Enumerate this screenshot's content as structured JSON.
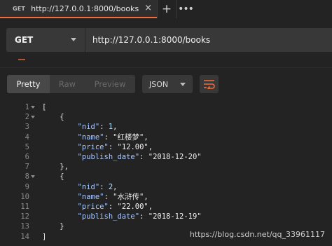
{
  "tab": {
    "method": "GET",
    "url": "http://127.0.0.1:8000/books",
    "close_glyph": "×",
    "add_glyph": "+",
    "more_glyph": "•••"
  },
  "request": {
    "method": "GET",
    "url": "http://127.0.0.1:8000/books"
  },
  "response_toolbar": {
    "views": [
      "Pretty",
      "Raw",
      "Preview"
    ],
    "active_view": "Pretty",
    "format": "JSON",
    "wrap_icon": "wrap-lines-icon"
  },
  "code": {
    "lines": [
      {
        "num": "1",
        "fold": true,
        "parts": [
          [
            "p",
            "["
          ]
        ]
      },
      {
        "num": "2",
        "fold": true,
        "parts": [
          [
            "p",
            "    {"
          ]
        ]
      },
      {
        "num": "3",
        "fold": false,
        "parts": [
          [
            "p",
            "        "
          ],
          [
            "k",
            "\"nid\""
          ],
          [
            "p",
            ": "
          ],
          [
            "n",
            "1"
          ],
          [
            "p",
            ","
          ]
        ]
      },
      {
        "num": "4",
        "fold": false,
        "parts": [
          [
            "p",
            "        "
          ],
          [
            "k",
            "\"name\""
          ],
          [
            "p",
            ": "
          ],
          [
            "s",
            "\"红楼梦\""
          ],
          [
            "p",
            ","
          ]
        ]
      },
      {
        "num": "5",
        "fold": false,
        "parts": [
          [
            "p",
            "        "
          ],
          [
            "k",
            "\"price\""
          ],
          [
            "p",
            ": "
          ],
          [
            "s",
            "\"12.00\""
          ],
          [
            "p",
            ","
          ]
        ]
      },
      {
        "num": "6",
        "fold": false,
        "parts": [
          [
            "p",
            "        "
          ],
          [
            "k",
            "\"publish_date\""
          ],
          [
            "p",
            ": "
          ],
          [
            "s",
            "\"2018-12-20\""
          ]
        ]
      },
      {
        "num": "7",
        "fold": false,
        "parts": [
          [
            "p",
            "    },"
          ]
        ]
      },
      {
        "num": "8",
        "fold": true,
        "parts": [
          [
            "p",
            "    {"
          ]
        ]
      },
      {
        "num": "9",
        "fold": false,
        "parts": [
          [
            "p",
            "        "
          ],
          [
            "k",
            "\"nid\""
          ],
          [
            "p",
            ": "
          ],
          [
            "n",
            "2"
          ],
          [
            "p",
            ","
          ]
        ]
      },
      {
        "num": "10",
        "fold": false,
        "parts": [
          [
            "p",
            "        "
          ],
          [
            "k",
            "\"name\""
          ],
          [
            "p",
            ": "
          ],
          [
            "s",
            "\"水浒传\""
          ],
          [
            "p",
            ","
          ]
        ]
      },
      {
        "num": "11",
        "fold": false,
        "parts": [
          [
            "p",
            "        "
          ],
          [
            "k",
            "\"price\""
          ],
          [
            "p",
            ": "
          ],
          [
            "s",
            "\"22.00\""
          ],
          [
            "p",
            ","
          ]
        ]
      },
      {
        "num": "12",
        "fold": false,
        "parts": [
          [
            "p",
            "        "
          ],
          [
            "k",
            "\"publish_date\""
          ],
          [
            "p",
            ": "
          ],
          [
            "s",
            "\"2018-12-19\""
          ]
        ]
      },
      {
        "num": "13",
        "fold": false,
        "parts": [
          [
            "p",
            "    }"
          ]
        ]
      },
      {
        "num": "14",
        "fold": false,
        "parts": [
          [
            "p",
            "]"
          ]
        ]
      }
    ]
  },
  "watermark": "https://blog.csdn.net/qq_33961117",
  "colors": {
    "accent": "#f26b3a",
    "background": "#232323",
    "panel": "#383838"
  }
}
